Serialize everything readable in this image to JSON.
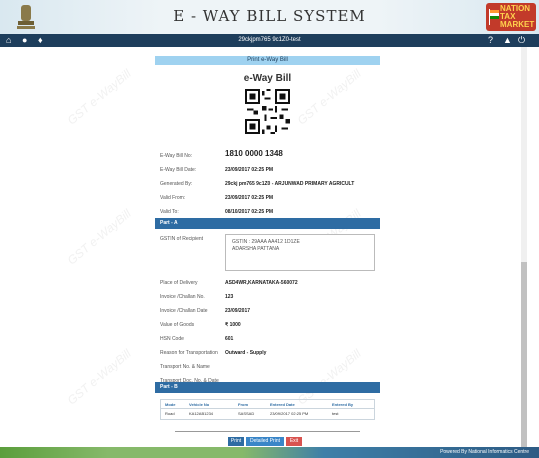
{
  "header": {
    "title": "E - WAY BILL SYSTEM",
    "brand_lines": [
      "NATION",
      "TAX",
      "MARKET"
    ]
  },
  "navbar": {
    "user_id": "29ckjpm765 9c1Z0-test",
    "icons": [
      "home-icon",
      "user-icon",
      "bell-icon",
      "help-icon",
      "tools-icon",
      "power-icon"
    ]
  },
  "page": {
    "print_bar": "Print e-Way Bill",
    "ewb_title": "e-Way Bill"
  },
  "details": [
    {
      "label": "E-Way Bill No:",
      "value": "1810 0000 1348"
    },
    {
      "label": "E-Way Bill Date:",
      "value": "23/09/2017 02:25 PM"
    },
    {
      "label": "Generated By:",
      "value": "29ckj pm765 9c1Z0 - ARJUNWAD PRIMARY AGRICULT"
    },
    {
      "label": "Valid From:",
      "value": "23/09/2017 02:25 PM"
    },
    {
      "label": "Valid To:",
      "value": "08/10/2017 02:25 PM"
    }
  ],
  "part_a": {
    "title": "Part - A",
    "gstin_label": "GSTIN of Recipient",
    "gstin_value": "GSTIN : 29AAA  AA412  1D1ZE",
    "recipient_name": "ADARSHA PATTANA",
    "rows": [
      {
        "label": "Place of Delivery",
        "value": "ASD4WR,KARNATAKA-560072"
      },
      {
        "label": "Invoice /Challan No.",
        "value": "123"
      },
      {
        "label": "Invoice /Challan Date",
        "value": "23/09/2017"
      },
      {
        "label": "Value of Goods",
        "value": "₹ 1000"
      },
      {
        "label": "HSN Code",
        "value": "601"
      },
      {
        "label": "Reason for Transportation",
        "value": "Outward - Supply"
      },
      {
        "label": "Transport No. & Name",
        "value": ""
      },
      {
        "label": "Transport Doc. No. & Date",
        "value": ""
      }
    ]
  },
  "part_b": {
    "title": "Part - B",
    "columns": [
      "Mode",
      "Vehicle No",
      "From",
      "Entered Date",
      "Entered By"
    ],
    "rows": [
      [
        "Road",
        "KA12AB1234",
        "SASSAD",
        "23/09/2017 02:25 PM",
        "test"
      ]
    ]
  },
  "buttons": {
    "print": "Print",
    "detailed_print": "Detailed Print",
    "exit": "Exit"
  },
  "footer": {
    "text": "Powered By National Informatics Centre"
  },
  "colors": {
    "navbar": "#1e3e5c",
    "section": "#2e6ca3",
    "print_bar": "#9fd2f0",
    "print_button": "#2e6ca3",
    "detailed_print_button": "#3a86c8",
    "exit_button": "#d9534f"
  }
}
